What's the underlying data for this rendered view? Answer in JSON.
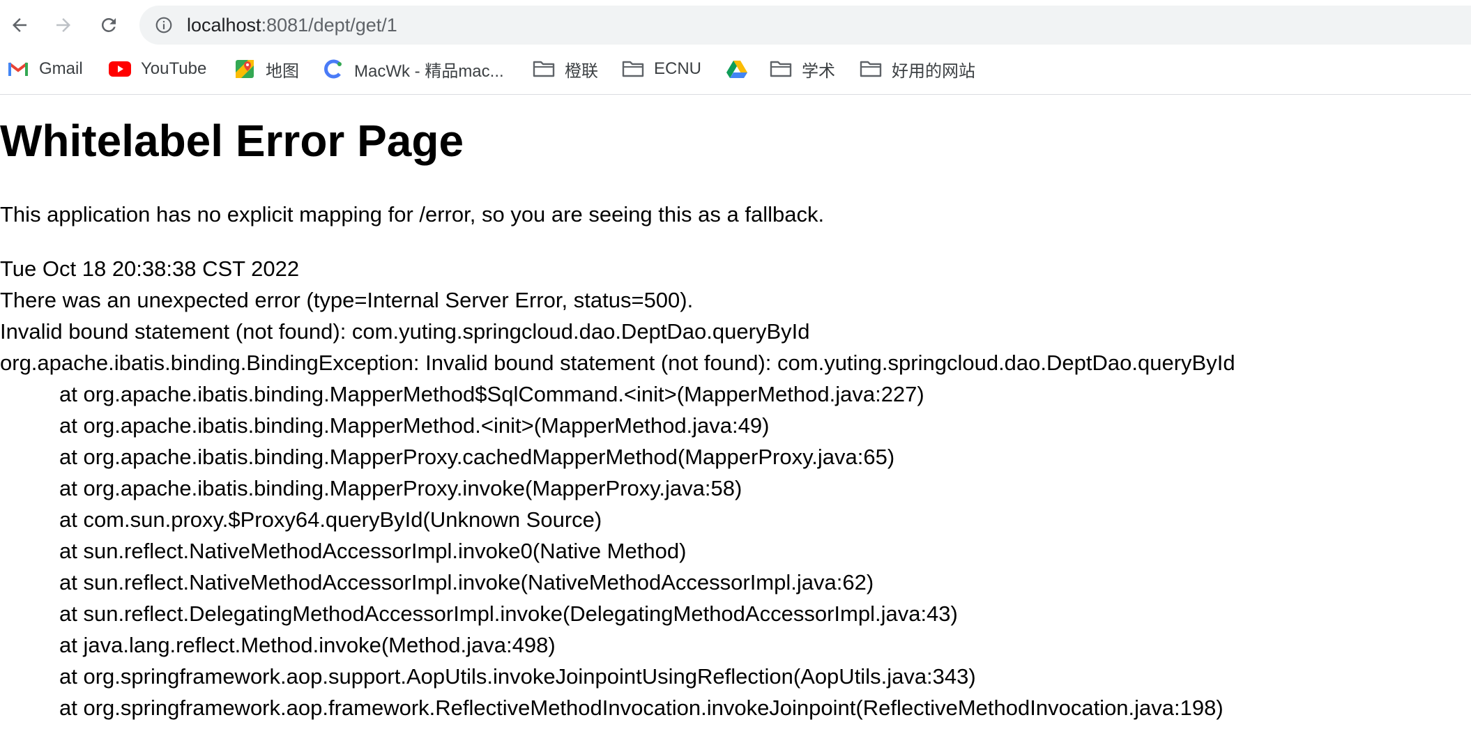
{
  "browser": {
    "url_host": "localhost",
    "url_path": ":8081/dept/get/1",
    "icons": {
      "back": "back-arrow-icon",
      "forward": "forward-arrow-icon",
      "reload": "reload-icon",
      "info": "info-icon"
    }
  },
  "bookmarks": [
    {
      "label": "Gmail",
      "icon": "gmail-icon"
    },
    {
      "label": "YouTube",
      "icon": "youtube-icon"
    },
    {
      "label": "地图",
      "icon": "maps-icon"
    },
    {
      "label": "MacWk - 精品mac...",
      "icon": "macwk-icon"
    },
    {
      "label": "橙联",
      "icon": "folder-icon"
    },
    {
      "label": "ECNU",
      "icon": "folder-icon"
    },
    {
      "label": "",
      "icon": "google-drive-icon"
    },
    {
      "label": "学术",
      "icon": "folder-icon"
    },
    {
      "label": "好用的网站",
      "icon": "folder-icon"
    }
  ],
  "page": {
    "title": "Whitelabel Error Page",
    "description": "This application has no explicit mapping for /error, so you are seeing this as a fallback.",
    "lines": [
      "Tue Oct 18 20:38:38 CST 2022",
      "There was an unexpected error (type=Internal Server Error, status=500).",
      "Invalid bound statement (not found): com.yuting.springcloud.dao.DeptDao.queryById",
      "org.apache.ibatis.binding.BindingException: Invalid bound statement (not found): com.yuting.springcloud.dao.DeptDao.queryById"
    ],
    "stack": [
      "at org.apache.ibatis.binding.MapperMethod$SqlCommand.<init>(MapperMethod.java:227)",
      "at org.apache.ibatis.binding.MapperMethod.<init>(MapperMethod.java:49)",
      "at org.apache.ibatis.binding.MapperProxy.cachedMapperMethod(MapperProxy.java:65)",
      "at org.apache.ibatis.binding.MapperProxy.invoke(MapperProxy.java:58)",
      "at com.sun.proxy.$Proxy64.queryById(Unknown Source)",
      "at sun.reflect.NativeMethodAccessorImpl.invoke0(Native Method)",
      "at sun.reflect.NativeMethodAccessorImpl.invoke(NativeMethodAccessorImpl.java:62)",
      "at sun.reflect.DelegatingMethodAccessorImpl.invoke(DelegatingMethodAccessorImpl.java:43)",
      "at java.lang.reflect.Method.invoke(Method.java:498)",
      "at org.springframework.aop.support.AopUtils.invokeJoinpointUsingReflection(AopUtils.java:343)",
      "at org.springframework.aop.framework.ReflectiveMethodInvocation.invokeJoinpoint(ReflectiveMethodInvocation.java:198)"
    ]
  },
  "colors": {
    "omnibox_bg": "#f1f3f4",
    "url_path": "#5f6368",
    "folder": "#5f6368",
    "gmail_red": "#ea4335",
    "youtube_red": "#ff0000"
  }
}
